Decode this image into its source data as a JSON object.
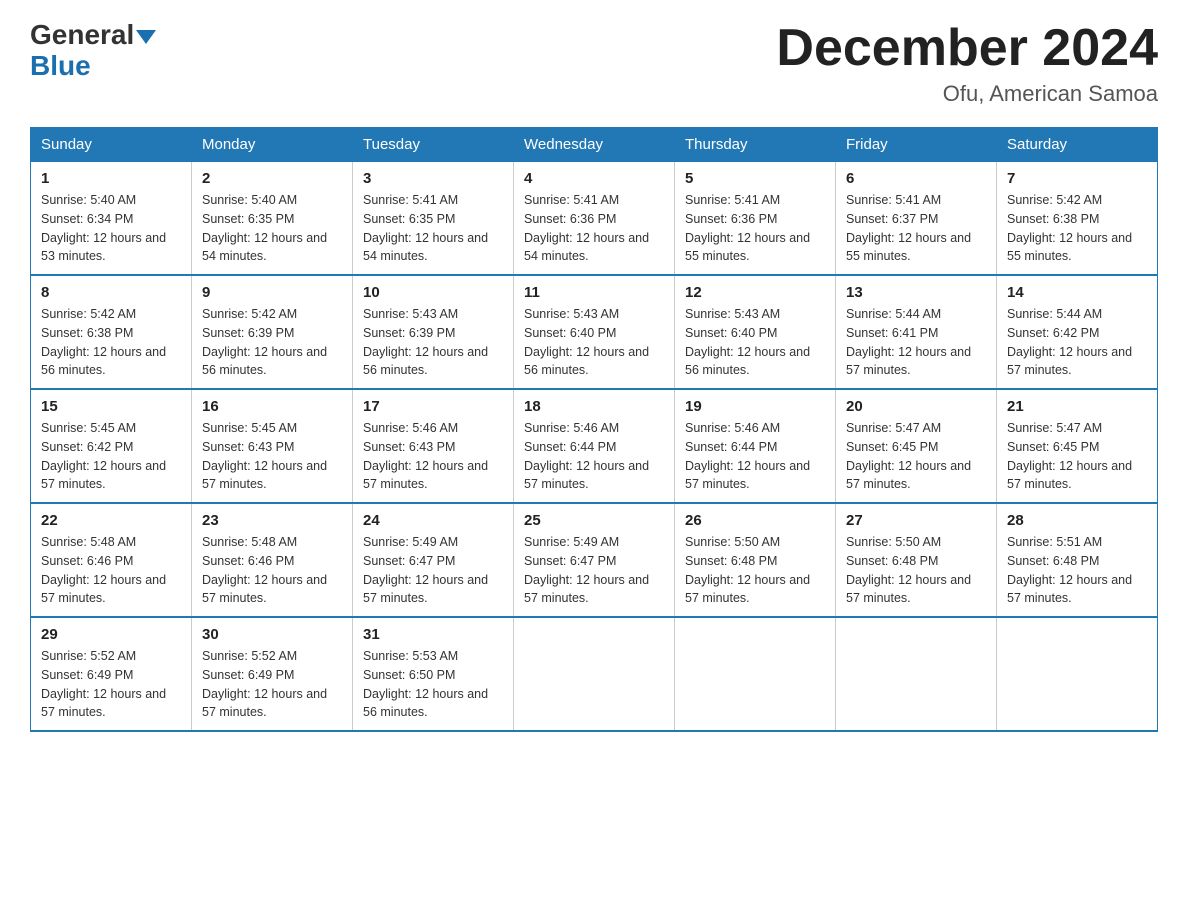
{
  "header": {
    "logo_general": "General",
    "logo_blue": "Blue",
    "month_title": "December 2024",
    "location": "Ofu, American Samoa"
  },
  "days_of_week": [
    "Sunday",
    "Monday",
    "Tuesday",
    "Wednesday",
    "Thursday",
    "Friday",
    "Saturday"
  ],
  "weeks": [
    [
      {
        "day": "1",
        "sunrise": "5:40 AM",
        "sunset": "6:34 PM",
        "daylight": "12 hours and 53 minutes."
      },
      {
        "day": "2",
        "sunrise": "5:40 AM",
        "sunset": "6:35 PM",
        "daylight": "12 hours and 54 minutes."
      },
      {
        "day": "3",
        "sunrise": "5:41 AM",
        "sunset": "6:35 PM",
        "daylight": "12 hours and 54 minutes."
      },
      {
        "day": "4",
        "sunrise": "5:41 AM",
        "sunset": "6:36 PM",
        "daylight": "12 hours and 54 minutes."
      },
      {
        "day": "5",
        "sunrise": "5:41 AM",
        "sunset": "6:36 PM",
        "daylight": "12 hours and 55 minutes."
      },
      {
        "day": "6",
        "sunrise": "5:41 AM",
        "sunset": "6:37 PM",
        "daylight": "12 hours and 55 minutes."
      },
      {
        "day": "7",
        "sunrise": "5:42 AM",
        "sunset": "6:38 PM",
        "daylight": "12 hours and 55 minutes."
      }
    ],
    [
      {
        "day": "8",
        "sunrise": "5:42 AM",
        "sunset": "6:38 PM",
        "daylight": "12 hours and 56 minutes."
      },
      {
        "day": "9",
        "sunrise": "5:42 AM",
        "sunset": "6:39 PM",
        "daylight": "12 hours and 56 minutes."
      },
      {
        "day": "10",
        "sunrise": "5:43 AM",
        "sunset": "6:39 PM",
        "daylight": "12 hours and 56 minutes."
      },
      {
        "day": "11",
        "sunrise": "5:43 AM",
        "sunset": "6:40 PM",
        "daylight": "12 hours and 56 minutes."
      },
      {
        "day": "12",
        "sunrise": "5:43 AM",
        "sunset": "6:40 PM",
        "daylight": "12 hours and 56 minutes."
      },
      {
        "day": "13",
        "sunrise": "5:44 AM",
        "sunset": "6:41 PM",
        "daylight": "12 hours and 57 minutes."
      },
      {
        "day": "14",
        "sunrise": "5:44 AM",
        "sunset": "6:42 PM",
        "daylight": "12 hours and 57 minutes."
      }
    ],
    [
      {
        "day": "15",
        "sunrise": "5:45 AM",
        "sunset": "6:42 PM",
        "daylight": "12 hours and 57 minutes."
      },
      {
        "day": "16",
        "sunrise": "5:45 AM",
        "sunset": "6:43 PM",
        "daylight": "12 hours and 57 minutes."
      },
      {
        "day": "17",
        "sunrise": "5:46 AM",
        "sunset": "6:43 PM",
        "daylight": "12 hours and 57 minutes."
      },
      {
        "day": "18",
        "sunrise": "5:46 AM",
        "sunset": "6:44 PM",
        "daylight": "12 hours and 57 minutes."
      },
      {
        "day": "19",
        "sunrise": "5:46 AM",
        "sunset": "6:44 PM",
        "daylight": "12 hours and 57 minutes."
      },
      {
        "day": "20",
        "sunrise": "5:47 AM",
        "sunset": "6:45 PM",
        "daylight": "12 hours and 57 minutes."
      },
      {
        "day": "21",
        "sunrise": "5:47 AM",
        "sunset": "6:45 PM",
        "daylight": "12 hours and 57 minutes."
      }
    ],
    [
      {
        "day": "22",
        "sunrise": "5:48 AM",
        "sunset": "6:46 PM",
        "daylight": "12 hours and 57 minutes."
      },
      {
        "day": "23",
        "sunrise": "5:48 AM",
        "sunset": "6:46 PM",
        "daylight": "12 hours and 57 minutes."
      },
      {
        "day": "24",
        "sunrise": "5:49 AM",
        "sunset": "6:47 PM",
        "daylight": "12 hours and 57 minutes."
      },
      {
        "day": "25",
        "sunrise": "5:49 AM",
        "sunset": "6:47 PM",
        "daylight": "12 hours and 57 minutes."
      },
      {
        "day": "26",
        "sunrise": "5:50 AM",
        "sunset": "6:48 PM",
        "daylight": "12 hours and 57 minutes."
      },
      {
        "day": "27",
        "sunrise": "5:50 AM",
        "sunset": "6:48 PM",
        "daylight": "12 hours and 57 minutes."
      },
      {
        "day": "28",
        "sunrise": "5:51 AM",
        "sunset": "6:48 PM",
        "daylight": "12 hours and 57 minutes."
      }
    ],
    [
      {
        "day": "29",
        "sunrise": "5:52 AM",
        "sunset": "6:49 PM",
        "daylight": "12 hours and 57 minutes."
      },
      {
        "day": "30",
        "sunrise": "5:52 AM",
        "sunset": "6:49 PM",
        "daylight": "12 hours and 57 minutes."
      },
      {
        "day": "31",
        "sunrise": "5:53 AM",
        "sunset": "6:50 PM",
        "daylight": "12 hours and 56 minutes."
      },
      null,
      null,
      null,
      null
    ]
  ]
}
